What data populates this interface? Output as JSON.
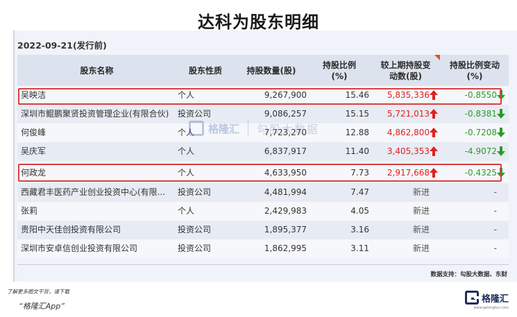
{
  "title": "达科为股东明细",
  "date_label": "2022-09-21(发行前)",
  "columns": [
    "股东名称",
    "股东性质",
    "持股数量(股)",
    "持股比例\n(%)",
    "较上期持股变\n动数(股)",
    "持股比例变动\n(%)"
  ],
  "rows": [
    {
      "name": "吴映洁",
      "type": "个人",
      "qty": "9,267,900",
      "ratio": "15.46",
      "change": "5,835,336",
      "ratio_change": "-0.8550",
      "up": true,
      "down": true
    },
    {
      "name": "深圳市鲲鹏聚贤投资管理企业(有限合伙)",
      "type": "投资公司",
      "qty": "9,086,257",
      "ratio": "15.15",
      "change": "5,721,013",
      "ratio_change": "-0.8381",
      "up": true,
      "down": true
    },
    {
      "name": "何俊峰",
      "type": "个人",
      "qty": "7,723,270",
      "ratio": "12.88",
      "change": "4,862,800",
      "ratio_change": "-0.7208",
      "up": true,
      "down": true
    },
    {
      "name": "吴庆军",
      "type": "个人",
      "qty": "6,837,917",
      "ratio": "11.40",
      "change": "3,405,353",
      "ratio_change": "-4.9072",
      "up": true,
      "down": true
    },
    {
      "name": "何政龙",
      "type": "个人",
      "qty": "4,633,950",
      "ratio": "7.73",
      "change": "2,917,668",
      "ratio_change": "-0.4325",
      "up": true,
      "down": true
    },
    {
      "name": "西藏君丰医药产业创业投资中心(有限...",
      "type": "投资公司",
      "qty": "4,481,994",
      "ratio": "7.47",
      "change": "新进",
      "ratio_change": "-",
      "up": false,
      "down": false
    },
    {
      "name": "张莉",
      "type": "个人",
      "qty": "2,429,983",
      "ratio": "4.05",
      "change": "新进",
      "ratio_change": "-",
      "up": false,
      "down": false
    },
    {
      "name": "贵阳中天佳创投资有限公司",
      "type": "投资公司",
      "qty": "1,895,377",
      "ratio": "3.16",
      "change": "新进",
      "ratio_change": "-",
      "up": false,
      "down": false
    },
    {
      "name": "深圳市安卓信创业投资有限公司",
      "type": "投资公司",
      "qty": "1,862,995",
      "ratio": "3.11",
      "change": "新进",
      "ratio_change": "-",
      "up": false,
      "down": false
    }
  ],
  "source": "数据支持：勾股大数据、东财",
  "download_note": "了解更多图文干货，请下载",
  "download_app": "“格隆汇App”",
  "brand": "格隆汇",
  "brand_sub": "www.gelonghui.com",
  "watermark_left": "格隆汇",
  "watermark_right": "勾股大数据",
  "colors": {
    "up_red": "#e02020",
    "down_green": "#2a9a2a",
    "highlight": "#d94040",
    "header_bg": "#dde3ee"
  }
}
